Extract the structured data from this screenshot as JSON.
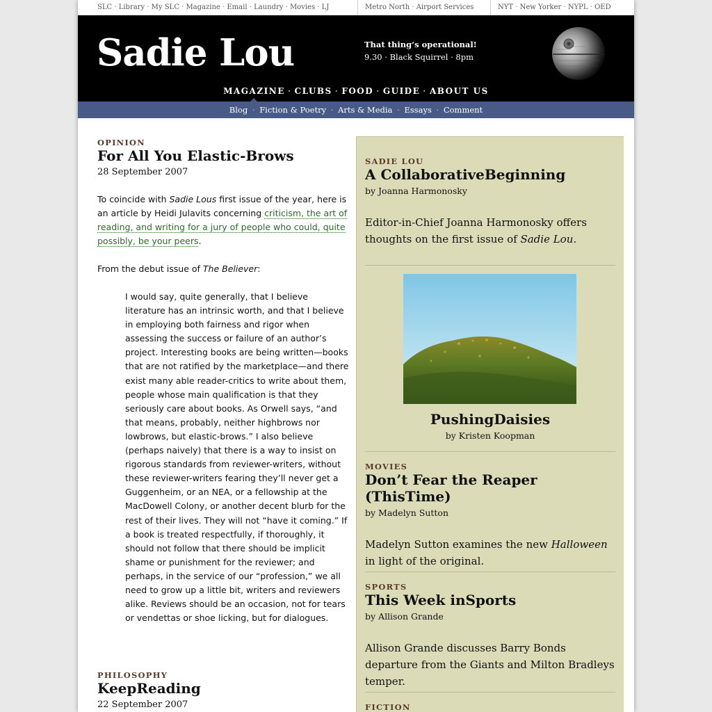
{
  "toplinks": {
    "group1": [
      "SLC",
      "Library",
      "My SLC",
      "Magazine",
      "Email",
      "Laundry",
      "Movies",
      "LJ"
    ],
    "group2": [
      "Metro North",
      "Airport Services"
    ],
    "group3": [
      "NYT",
      "New Yorker",
      "NYPL",
      "OED"
    ]
  },
  "masthead": {
    "logo": "Sadie Lou",
    "tagline_line1": "That thing’s operational!",
    "tagline_line2": "9.30 · Black Squirrel · 8pm"
  },
  "mainnav": [
    "MAGAZINE",
    "CLUBS",
    "FOOD",
    "GUIDE",
    "ABOUT US"
  ],
  "subnav": [
    "Blog",
    "Fiction & Poetry",
    "Arts & Media",
    "Essays",
    "Comment"
  ],
  "main": {
    "story1": {
      "kicker": "OPINION",
      "title": "For All You Elastic-Brows",
      "date": "28 September 2007",
      "intro_pre": "To coincide with ",
      "intro_em": "Sadie Lous",
      "intro_mid": " first issue of the year, here is an article by Heidi Julavits concerning ",
      "intro_link": "criticism, the art of reading, and writing for a jury of people who could, quite possibly, be your peers",
      "intro_post": ".",
      "from_pre": "From the debut issue of ",
      "from_em": "The Believer",
      "from_post": ":",
      "quote": "I would say, quite generally, that I believe literature has an intrinsic worth, and that I believe in employing both fairness and rigor when assessing the success or failure of an author’s project. Interesting books are being written—books that are not ratified by the marketplace—and there exist many able reader-critics to write about them, people whose main qualification is that they seriously care about books. As Orwell says, “and that means, probably, neither highbrows nor lowbrows, but elastic-brows.” I also believe (perhaps naively) that there is a way to insist on rigorous standards from reviewer-writers, without these reviewer-writers fearing they’ll never get a Guggenheim, or an NEA, or a fellowship at the MacDowell Colony, or another decent blurb for the rest of their lives. They will not “have it coming.” If a book is treated respectfully, if thoroughly, it should not follow that there should be implicit shame or punishment for the reviewer; and perhaps, in the service of our “profession,” we all need to grow up a little bit, writers and reviewers alike. Reviews should be an occasion, not for tears or vendettas or shoe licking, but for dialogues."
    },
    "story2": {
      "kicker": "PHILOSOPHY",
      "title": "KeepReading",
      "date": "22 September 2007"
    }
  },
  "sidebar": {
    "item1": {
      "kicker": "SADIE LOU",
      "title": "A CollaborativeBeginning",
      "byline": "by Joanna Harmonosky",
      "desc_pre": "Editor-in-Chief Joanna Harmonosky offers thoughts on the first issue of ",
      "desc_em": "Sadie Lou",
      "desc_post": "."
    },
    "item2": {
      "title": "PushingDaisies",
      "byline": "by Kristen Koopman"
    },
    "item3": {
      "kicker": "MOVIES",
      "title": "Don’t Fear the Reaper (ThisTime)",
      "byline": "by Madelyn Sutton",
      "desc_pre": "Madelyn Sutton examines the new ",
      "desc_em": "Halloween",
      "desc_post": " in light of the original."
    },
    "item4": {
      "kicker": "SPORTS",
      "title": "This Week inSports",
      "byline": "by Allison Grande",
      "desc": "Allison Grande discusses Barry Bonds departure from the Giants and Milton Bradleys temper."
    },
    "item5": {
      "kicker": "FICTION"
    }
  },
  "colors": {
    "subnav_bg": "#475b86",
    "sidebar_bg": "#dcdbb8",
    "link": "#2e6b2a",
    "kicker": "#5a3a2a"
  },
  "icons": [
    "death-star-icon"
  ]
}
